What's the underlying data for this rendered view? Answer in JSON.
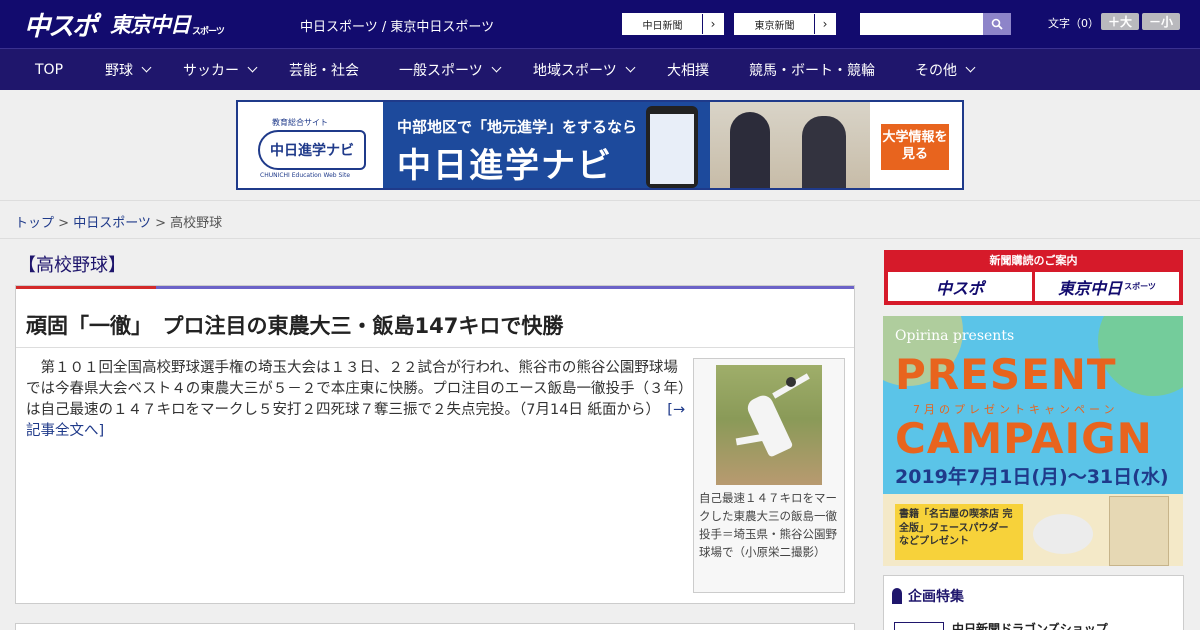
{
  "header": {
    "logo_chuspo": "中スポ",
    "logo_tokyo": "東京中日",
    "logo_tokyo_sub": "スポーツ",
    "site_title": "中日スポーツ / 東京中日スポーツ",
    "ext_links": [
      {
        "label": "中日新聞"
      },
      {
        "label": "東京新聞"
      }
    ],
    "search": {
      "placeholder": "",
      "value": ""
    },
    "font_size_label": "文字（0）",
    "font_increase": "＋大",
    "font_decrease": "－小"
  },
  "nav": {
    "items": [
      {
        "label": "TOP"
      },
      {
        "label": "野球"
      },
      {
        "label": "サッカー"
      },
      {
        "label": "芸能・社会"
      },
      {
        "label": "一般スポーツ"
      },
      {
        "label": "地域スポーツ"
      },
      {
        "label": "大相撲"
      },
      {
        "label": "競馬・ボート・競輪"
      },
      {
        "label": "その他"
      }
    ]
  },
  "ad_banner": {
    "badge": "中日進学ナビ",
    "badge_top": "教育総合サイト",
    "badge_bottom": "CHUNICHI Education Web Site",
    "line1": "中部地区で「地元進学」をするなら",
    "line2": "中日進学ナビ",
    "cta": "大学情報を見る"
  },
  "breadcrumb": {
    "home": "トップ",
    "sep": " > ",
    "section": "中日スポーツ",
    "current": "高校野球"
  },
  "section_heading": "【高校野球】",
  "article": {
    "title": "頑固「一徹」　プロ注目の東農大三・飯島147キロで快勝",
    "body": "第１０１回全国高校野球選手権の埼玉大会は１３日、２２試合が行われ、熊谷市の熊谷公園野球場では今春県大会ベスト４の東農大三が５－２で本庄東に快勝。プロ注目のエース飯島一徹投手（３年）は自己最速の１４７キロをマークし５安打２四死球７奪三振で２失点完投。（7月14日 紙面から）",
    "more_link": "[→記事全文へ]",
    "photo_caption": "自己最速１４７キロをマークした東農大三の飯島一徹投手＝埼玉県・熊谷公園野球場で（小原栄二撮影）"
  },
  "sidebar": {
    "subscribe_head": "新聞購読のご案内",
    "subscribe_chuspo": "中スポ",
    "subscribe_tokyo": "東京中日",
    "subscribe_tokyo_sub": "スポーツ",
    "promo": {
      "brand": "Opirina presents",
      "present": "PRESENT",
      "subtitle": "7月のプレゼントキャンペーン",
      "campaign": "CAMPAIGN",
      "dates": "2019年7月1日(月)～31日(水)",
      "book_text": "書籍「名古屋の喫茶店 完全版」フェースパウダー などプレゼント"
    },
    "feature_title": "企画特集",
    "feature_item": "中日新聞ドラゴンズショップ"
  }
}
